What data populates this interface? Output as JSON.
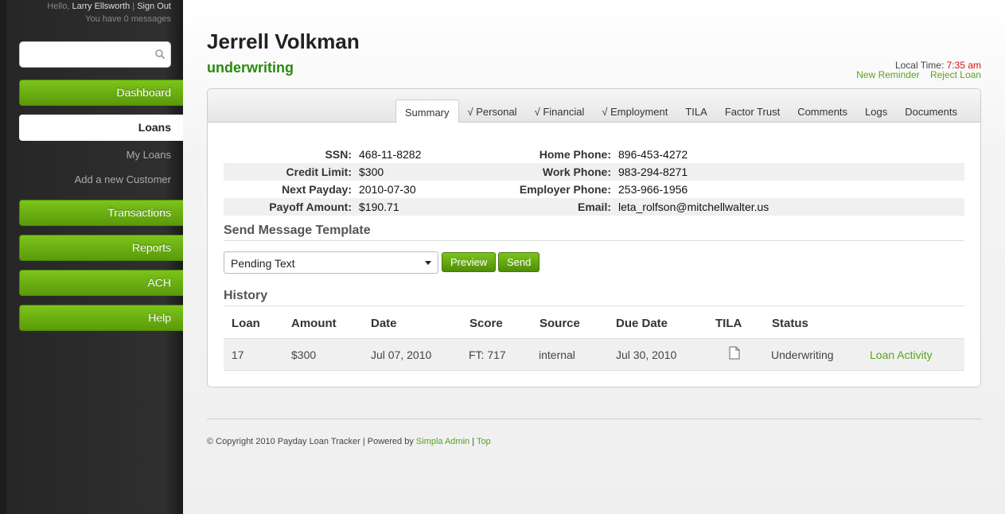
{
  "header": {
    "greeting": "Hello,",
    "user_name": "Larry Ellsworth",
    "separator": "|",
    "sign_out": "Sign Out",
    "messages": "You have 0 messages"
  },
  "search": {
    "placeholder": "",
    "icon": "search-icon"
  },
  "sidebar": {
    "dashboard": "Dashboard",
    "loans": "Loans",
    "my_loans": "My Loans",
    "add_customer": "Add a new Customer",
    "transactions": "Transactions",
    "reports": "Reports",
    "ach": "ACH",
    "help": "Help"
  },
  "page": {
    "title": "Jerrell Volkman",
    "status": "underwriting",
    "local_time_label": "Local Time:",
    "local_time": "7:35 am",
    "new_reminder": "New Reminder",
    "reject_loan": "Reject Loan"
  },
  "tabs": [
    "Summary",
    "√ Personal",
    "√ Financial",
    "√ Employment",
    "TILA",
    "Factor Trust",
    "Comments",
    "Logs",
    "Documents"
  ],
  "summary": {
    "ssn_label": "SSN:",
    "ssn": "468-11-8282",
    "credit_label": "Credit Limit:",
    "credit": "$300",
    "payday_label": "Next Payday:",
    "payday": "2010-07-30",
    "payoff_label": "Payoff Amount:",
    "payoff": "$190.71",
    "home_label": "Home Phone:",
    "home": "896-453-4272",
    "work_label": "Work Phone:",
    "work": "983-294-8271",
    "employer_label": "Employer Phone:",
    "employer": "253-966-1956",
    "email_label": "Email:",
    "email": "leta_rolfson@mitchellwalter.us"
  },
  "message": {
    "title": "Send Message Template",
    "selected": "Pending Text",
    "preview": "Preview",
    "send": "Send"
  },
  "history": {
    "title": "History",
    "columns": [
      "Loan",
      "Amount",
      "Date",
      "Score",
      "Source",
      "Due Date",
      "TILA",
      "Status"
    ],
    "row": {
      "loan": "17",
      "amount": "$300",
      "date": "Jul 07, 2010",
      "score": "FT: 717",
      "source": "internal",
      "due": "Jul 30, 2010",
      "tila_icon": "document-icon",
      "status": "Underwriting",
      "activity": "Loan Activity"
    }
  },
  "footer": {
    "copyright": "© Copyright 2010 Payday Loan Tracker | Powered by",
    "powered": "Simpla Admin",
    "sep": "|",
    "top": "Top"
  },
  "colors": {
    "accent_green": "#57a518",
    "title_green": "#2b8a0c",
    "time_red": "#e01010"
  }
}
